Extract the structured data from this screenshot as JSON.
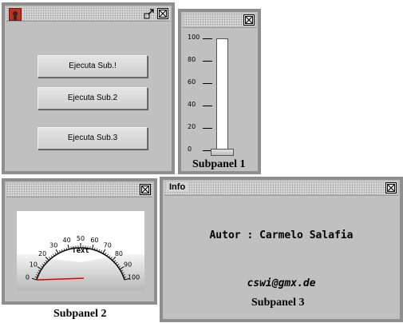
{
  "main_panel": {
    "buttons": [
      "Ejecuta Sub.!",
      "Ejecuta Sub.2",
      "Ejecuta Sub.3"
    ]
  },
  "subpanel1": {
    "caption": "Subpanel 1",
    "scale_labels": [
      "100",
      "80",
      "60",
      "40",
      "20",
      "0"
    ],
    "slider_value": 0
  },
  "subpanel2": {
    "caption": "Subpanel 2",
    "gauge_text": "Text",
    "gauge_labels": [
      "0",
      "10",
      "20",
      "30",
      "40",
      "50",
      "60",
      "70",
      "80",
      "90",
      "100"
    ],
    "needle_value": 0
  },
  "subpanel3": {
    "title": "Info",
    "author": "Autor : Carmelo Salafia",
    "email": "cswi@gmx.de",
    "caption": "Subpanel 3"
  },
  "colors": {
    "panel_bg": "#c0c0c0",
    "border": "#8e8e8e",
    "needle": "#e00000",
    "app_icon": "#c03020"
  },
  "icons": [
    "app-icon",
    "restore-icon",
    "close-icon"
  ]
}
